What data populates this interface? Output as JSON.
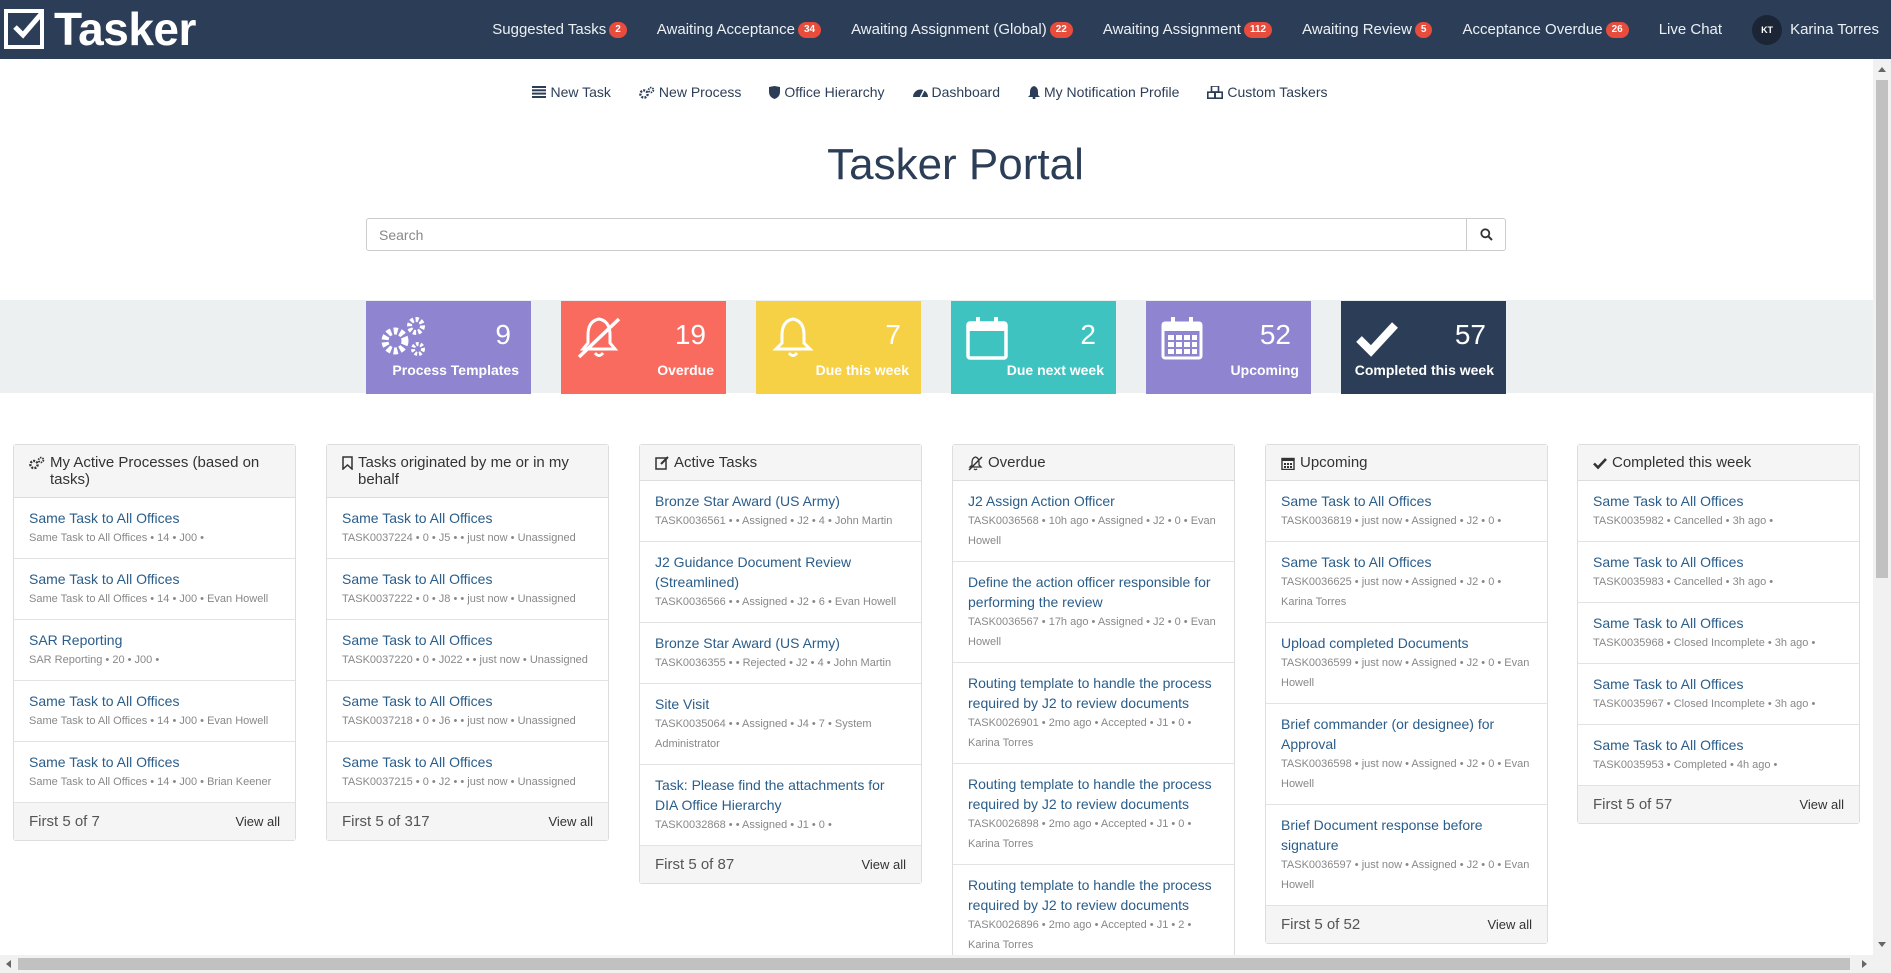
{
  "brand": {
    "name": "Tasker"
  },
  "topnav": [
    {
      "label": "Suggested Tasks",
      "badge": "2"
    },
    {
      "label": "Awaiting Acceptance",
      "badge": "34"
    },
    {
      "label": "Awaiting Assignment (Global)",
      "badge": "22"
    },
    {
      "label": "Awaiting Assignment",
      "badge": "112"
    },
    {
      "label": "Awaiting Review",
      "badge": "5"
    },
    {
      "label": "Acceptance Overdue",
      "badge": "26"
    },
    {
      "label": "Live Chat"
    }
  ],
  "user": {
    "initials": "KT",
    "name": "Karina Torres"
  },
  "subnav": [
    {
      "label": "New Task",
      "icon": "list-icon"
    },
    {
      "label": "New Process",
      "icon": "cogs-icon"
    },
    {
      "label": "Office Hierarchy",
      "icon": "shield-icon"
    },
    {
      "label": "Dashboard",
      "icon": "dashboard-icon"
    },
    {
      "label": "My Notification Profile",
      "icon": "bell-icon"
    },
    {
      "label": "Custom Taskers",
      "icon": "cubes-icon"
    }
  ],
  "page_title": "Tasker Portal",
  "search": {
    "placeholder": "Search",
    "value": ""
  },
  "tiles": [
    {
      "number": "9",
      "label": "Process Templates",
      "color": "#8e84cf",
      "icon": "cogs-icon"
    },
    {
      "number": "19",
      "label": "Overdue",
      "color": "#fa6b5f",
      "icon": "bell-slash-icon"
    },
    {
      "number": "7",
      "label": "Due this week",
      "color": "#f7d145",
      "icon": "bell-icon"
    },
    {
      "number": "2",
      "label": "Due next week",
      "color": "#3ec3c1",
      "icon": "calendar-empty-icon"
    },
    {
      "number": "52",
      "label": "Upcoming",
      "color": "#8e84cf",
      "icon": "calendar-icon"
    },
    {
      "number": "57",
      "label": "Completed this week",
      "color": "#2c3e57",
      "icon": "check-icon"
    }
  ],
  "panels": [
    {
      "title": "My Active Processes (based on tasks)",
      "icon": "cogs-icon",
      "items": [
        {
          "title": "Same Task to All Offices",
          "meta": "Same Task to All Offices • 14 • J00 •"
        },
        {
          "title": "Same Task to All Offices",
          "meta": "Same Task to All Offices • 14 • J00 • Evan Howell"
        },
        {
          "title": "SAR Reporting",
          "meta": "SAR Reporting • 20 • J00 •"
        },
        {
          "title": "Same Task to All Offices",
          "meta": "Same Task to All Offices • 14 • J00 • Evan Howell"
        },
        {
          "title": "Same Task to All Offices",
          "meta": "Same Task to All Offices • 14 • J00 • Brian Keener"
        }
      ],
      "footer": {
        "count": "First 5 of 7",
        "link": "View all"
      }
    },
    {
      "title": "Tasks originated by me or in my behalf",
      "icon": "bookmark-icon",
      "items": [
        {
          "title": "Same Task to All Offices",
          "meta": "TASK0037224 • 0 • J5 • • just now • Unassigned"
        },
        {
          "title": "Same Task to All Offices",
          "meta": "TASK0037222 • 0 • J8 • • just now • Unassigned"
        },
        {
          "title": "Same Task to All Offices",
          "meta": "TASK0037220 • 0 • J022 • • just now • Unassigned"
        },
        {
          "title": "Same Task to All Offices",
          "meta": "TASK0037218 • 0 • J6 • • just now • Unassigned"
        },
        {
          "title": "Same Task to All Offices",
          "meta": "TASK0037215 • 0 • J2 • • just now • Unassigned"
        }
      ],
      "footer": {
        "count": "First 5 of 317",
        "link": "View all"
      }
    },
    {
      "title": "Active Tasks",
      "icon": "edit-icon",
      "items": [
        {
          "title": "Bronze Star Award (US Army)",
          "meta": "TASK0036561 • • Assigned • J2 • 4 • John Martin"
        },
        {
          "title": "J2 Guidance Document Review (Streamlined)",
          "meta": "TASK0036566 • • Assigned • J2 • 6 • Evan Howell"
        },
        {
          "title": "Bronze Star Award (US Army)",
          "meta": "TASK0036355 • • Rejected • J2 • 4 • John Martin"
        },
        {
          "title": "Site Visit",
          "meta": "TASK0035064 • • Assigned • J4 • 7 • System Administrator"
        },
        {
          "title": "Task: Please find the attachments for DIA Office Hierarchy",
          "meta": "TASK0032868 • • Assigned • J1 • 0 •"
        }
      ],
      "footer": {
        "count": "First 5 of 87",
        "link": "View all"
      }
    },
    {
      "title": "Overdue",
      "icon": "bell-slash-icon",
      "items": [
        {
          "title": "J2 Assign Action Officer",
          "meta": "TASK0036568 • 10h ago • Assigned • J2 • 0 • Evan Howell"
        },
        {
          "title": "Define the action officer responsible for performing the review",
          "meta": "TASK0036567 • 17h ago • Assigned • J2 • 0 • Evan Howell"
        },
        {
          "title": "Routing template to handle the process required by J2 to review documents",
          "meta": "TASK0026901 • 2mo ago • Accepted • J1 • 0 • Karina Torres"
        },
        {
          "title": "Routing template to handle the process required by J2 to review documents",
          "meta": "TASK0026898 • 2mo ago • Accepted • J1 • 0 • Karina Torres"
        },
        {
          "title": "Routing template to handle the process required by J2 to review documents",
          "meta": "TASK0026896 • 2mo ago • Accepted • J1 • 2 • Karina Torres"
        }
      ]
    },
    {
      "title": "Upcoming",
      "icon": "calendar-icon",
      "items": [
        {
          "title": "Same Task to All Offices",
          "meta": "TASK0036819 • just now • Assigned • J2 • 0 •"
        },
        {
          "title": "Same Task to All Offices",
          "meta": "TASK0036625 • just now • Assigned • J2 • 0 • Karina Torres"
        },
        {
          "title": "Upload completed Documents",
          "meta": "TASK0036599 • just now • Assigned • J2 • 0 • Evan Howell"
        },
        {
          "title": "Brief commander (or designee) for Approval",
          "meta": "TASK0036598 • just now • Assigned • J2 • 0 • Evan Howell"
        },
        {
          "title": "Brief Document response before signature",
          "meta": "TASK0036597 • just now • Assigned • J2 • 0 • Evan Howell"
        }
      ],
      "footer": {
        "count": "First 5 of 52",
        "link": "View all"
      }
    },
    {
      "title": "Completed this week",
      "icon": "check-icon",
      "items": [
        {
          "title": "Same Task to All Offices",
          "meta": "TASK0035982 • Cancelled • 3h ago •"
        },
        {
          "title": "Same Task to All Offices",
          "meta": "TASK0035983 • Cancelled • 3h ago •"
        },
        {
          "title": "Same Task to All Offices",
          "meta": "TASK0035968 • Closed Incomplete • 3h ago •"
        },
        {
          "title": "Same Task to All Offices",
          "meta": "TASK0035967 • Closed Incomplete • 3h ago •"
        },
        {
          "title": "Same Task to All Offices",
          "meta": "TASK0035953 • Completed • 4h ago •"
        }
      ],
      "footer": {
        "count": "First 5 of 57",
        "link": "View all"
      }
    }
  ]
}
